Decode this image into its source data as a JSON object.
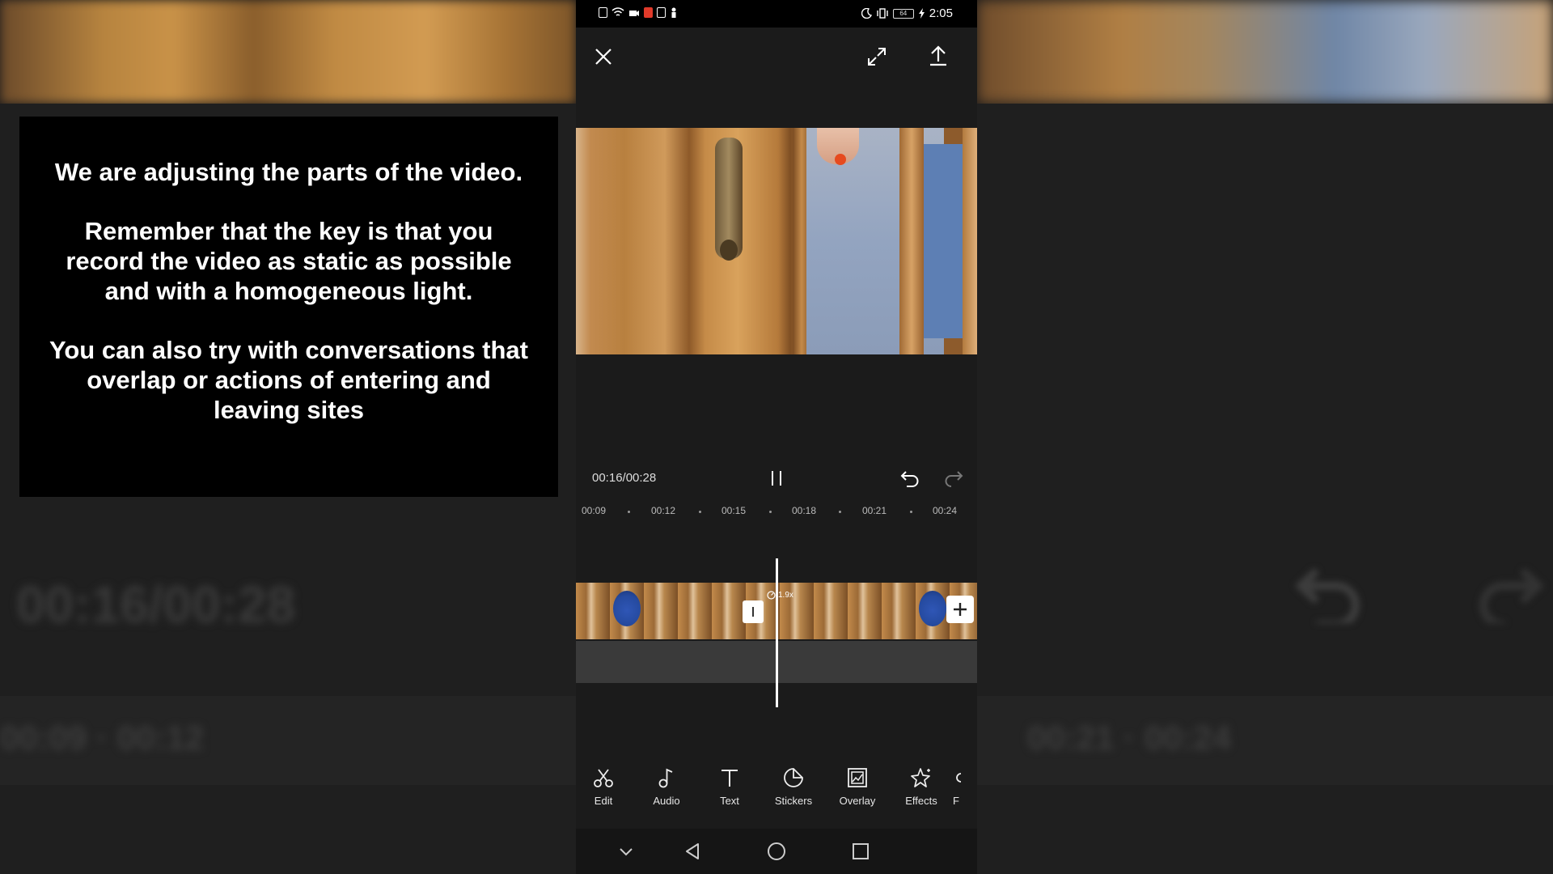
{
  "caption": {
    "paragraphs": [
      "We are adjusting the parts of the video.",
      "Remember that the key is that you record the video as static as possible and with a homogeneous light.",
      "You can also try with conversations that overlap or actions of entering and leaving sites"
    ]
  },
  "status_bar": {
    "time": "2:05",
    "battery": "64"
  },
  "player": {
    "time_readout": "00:16/00:28"
  },
  "ruler": {
    "ticks": [
      "00:09",
      "00:12",
      "00:15",
      "00:18",
      "00:21",
      "00:24"
    ]
  },
  "timeline": {
    "speed_label": "1.9x"
  },
  "toolbar": {
    "items": [
      {
        "label": "Edit",
        "icon": "scissors-icon"
      },
      {
        "label": "Audio",
        "icon": "music-note-icon"
      },
      {
        "label": "Text",
        "icon": "text-icon"
      },
      {
        "label": "Stickers",
        "icon": "sticker-icon"
      },
      {
        "label": "Overlay",
        "icon": "overlay-icon"
      },
      {
        "label": "Effects",
        "icon": "sparkle-star-icon"
      },
      {
        "label": "F",
        "icon": "partial-tool-icon"
      }
    ]
  },
  "background_ghost": {
    "time_readout": "00:16/00:28",
    "ticks_left": "00:09   ·   00:12",
    "ticks_right": "00:21   ·   00:24"
  }
}
